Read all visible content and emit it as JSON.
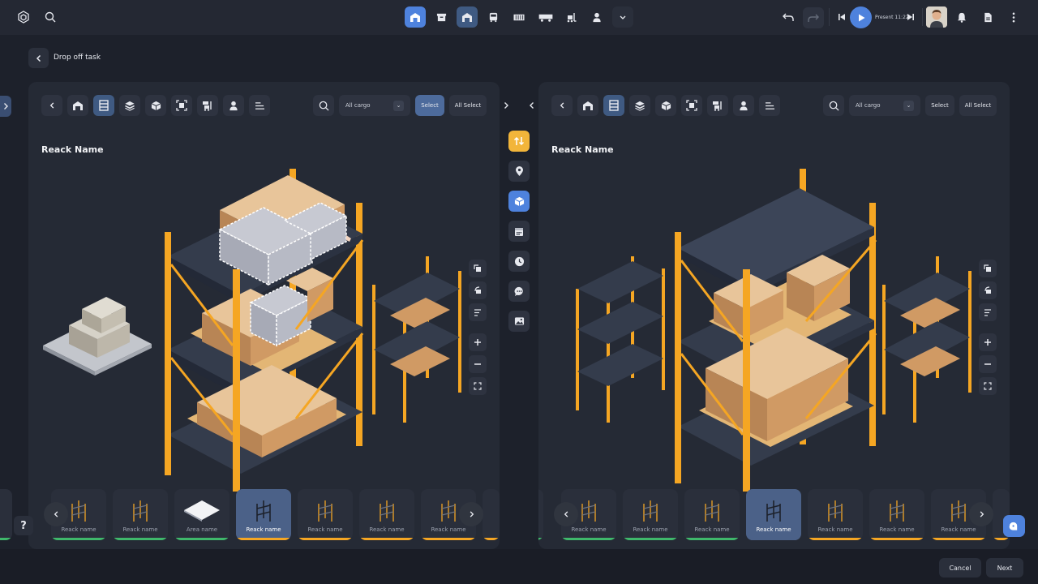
{
  "header": {
    "present_label": "Present 11:22"
  },
  "page": {
    "back_label": "Drop off task"
  },
  "panels": [
    {
      "title": "Reack Name",
      "filter": "All cargo",
      "select_label": "Select",
      "all_select_label": "All Select",
      "cards": [
        {
          "label": "Reack name",
          "status_color": "#3fb86b"
        },
        {
          "label": "Reack name",
          "status_color": "#3fb86b"
        },
        {
          "label": "Area name",
          "status_color": "#3fb86b"
        },
        {
          "label": "Reack name",
          "status_color": "#f5a623"
        },
        {
          "label": "Reack name",
          "status_color": "#f5a623"
        },
        {
          "label": "Reack name",
          "status_color": "#f5a623"
        },
        {
          "label": "Reack name",
          "status_color": "#f5a623"
        }
      ]
    },
    {
      "title": "Reack Name",
      "filter": "All cargo",
      "select_label": "Select",
      "all_select_label": "All Select",
      "cards": [
        {
          "label": "Reack name",
          "status_color": "#3fb86b"
        },
        {
          "label": "Reack name",
          "status_color": "#3fb86b"
        },
        {
          "label": "Reack name",
          "status_color": "#3fb86b"
        },
        {
          "label": "Reack name",
          "status_color": "#f5a623"
        },
        {
          "label": "Reack name",
          "status_color": "#f5a623"
        },
        {
          "label": "Reack name",
          "status_color": "#f5a623"
        },
        {
          "label": "Reack name",
          "status_color": "#f5a623"
        }
      ]
    }
  ],
  "footer": {
    "cancel_label": "Cancel",
    "next_label": "Next"
  },
  "help_label": "?",
  "colors": {
    "accent": "#4e82dd",
    "selected_tool": "#3f5a82",
    "rack_orange": "#f5a623",
    "status_green": "#3fb86b"
  }
}
